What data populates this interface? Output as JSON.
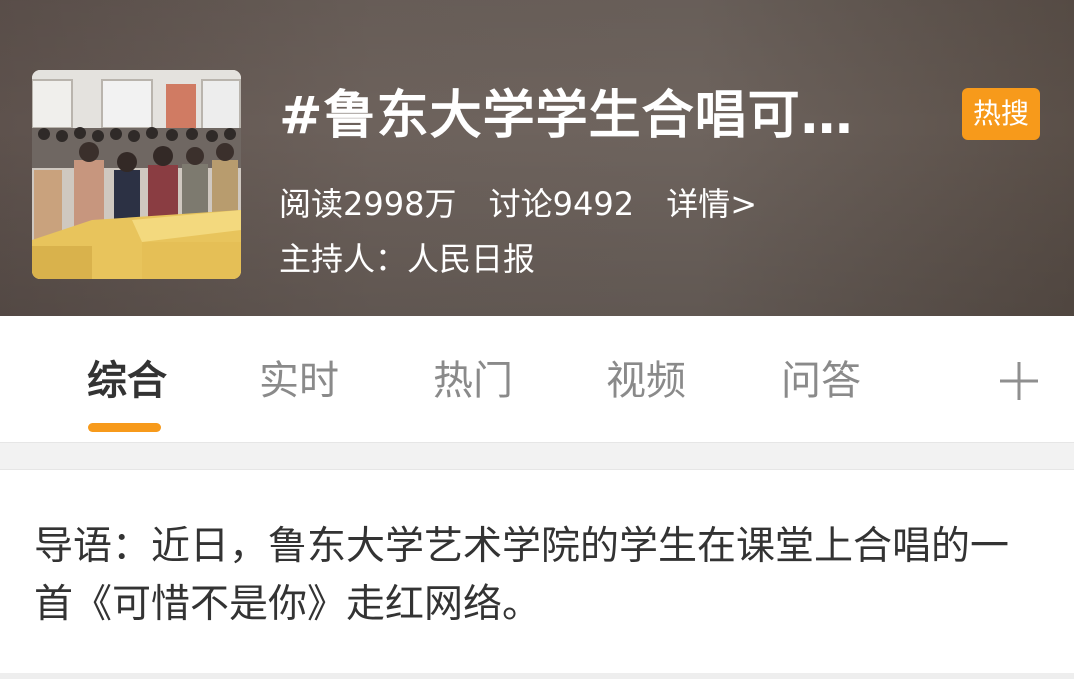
{
  "header": {
    "title": "#鲁东大学学生合唱可…",
    "hot_badge": "热搜",
    "reads": "阅读2998万",
    "discussions": "讨论9492",
    "details": "详情>",
    "host": "主持人：人民日报"
  },
  "tabs": [
    {
      "label": "综合",
      "active": true
    },
    {
      "label": "实时",
      "active": false
    },
    {
      "label": "热门",
      "active": false
    },
    {
      "label": "视频",
      "active": false
    },
    {
      "label": "问答",
      "active": false
    }
  ],
  "add_tab_icon": "plus-icon",
  "intro": {
    "text": "导语：近日，鲁东大学艺术学院的学生在课堂上合唱的一首《可惜不是你》走红网络。"
  },
  "colors": {
    "accent": "#f79a1b",
    "active_tab_text": "#333333",
    "inactive_tab_text": "#8a8a8a",
    "body_text": "#333333"
  }
}
